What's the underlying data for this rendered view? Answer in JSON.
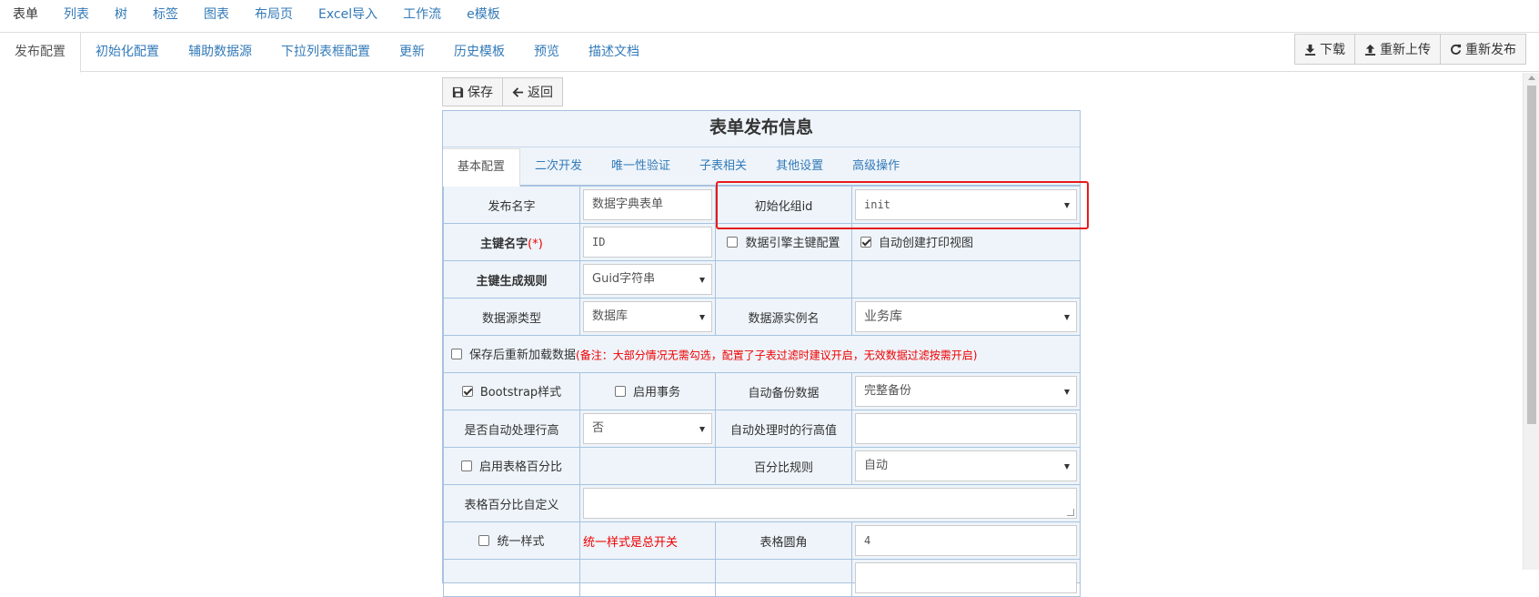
{
  "top_nav": {
    "items": [
      "表单",
      "列表",
      "树",
      "标签",
      "图表",
      "布局页",
      "Excel导入",
      "工作流",
      "e模板"
    ]
  },
  "sub_nav": {
    "tabs": [
      "发布配置",
      "初始化配置",
      "辅助数据源",
      "下拉列表框配置",
      "更新",
      "历史模板",
      "预览",
      "描述文档"
    ]
  },
  "top_buttons": {
    "download": "下载",
    "reupload": "重新上传",
    "republish": "重新发布"
  },
  "actions": {
    "save": "保存",
    "back": "返回"
  },
  "panel": {
    "title": "表单发布信息",
    "tabs": [
      "基本配置",
      "二次开发",
      "唯一性验证",
      "子表相关",
      "其他设置",
      "高级操作"
    ]
  },
  "form": {
    "publish_name_label": "发布名字",
    "publish_name_value": "数据字典表单",
    "init_group_label": "初始化组id",
    "init_group_value": "init",
    "pk_name_label": "主键名字",
    "required_mark": "(*)",
    "pk_name_value": "ID",
    "engine_pk_label": "数据引擎主键配置",
    "auto_print_label": "自动创建打印视图",
    "pk_rule_label": "主键生成规则",
    "pk_rule_value": "Guid字符串",
    "ds_type_label": "数据源类型",
    "ds_type_value": "数据库",
    "ds_instance_label": "数据源实例名",
    "ds_instance_value": "业务库",
    "reload_label": "保存后重新加载数据",
    "reload_note": "(备注：大部分情况无需勾选，配置了子表过滤时建议开启，无效数据过滤按需开启)",
    "bootstrap_label": "Bootstrap样式",
    "transaction_label": "启用事务",
    "auto_backup_label": "自动备份数据",
    "auto_backup_value": "完整备份",
    "auto_row_height_label": "是否自动处理行高",
    "auto_row_height_value": "否",
    "row_height_value_label": "自动处理时的行高值",
    "row_height_value": "",
    "table_percent_label": "启用表格百分比",
    "percent_rule_label": "百分比规则",
    "percent_rule_value": "自动",
    "percent_custom_label": "表格百分比自定义",
    "unify_style_label": "统一样式",
    "unify_style_note": "统一样式是总开关",
    "table_radius_label": "表格圆角",
    "table_radius_value": "4"
  },
  "checkboxes": {
    "engine_pk": false,
    "auto_print": true,
    "reload": false,
    "bootstrap": true,
    "transaction": false,
    "table_percent": false,
    "unify_style": false
  }
}
